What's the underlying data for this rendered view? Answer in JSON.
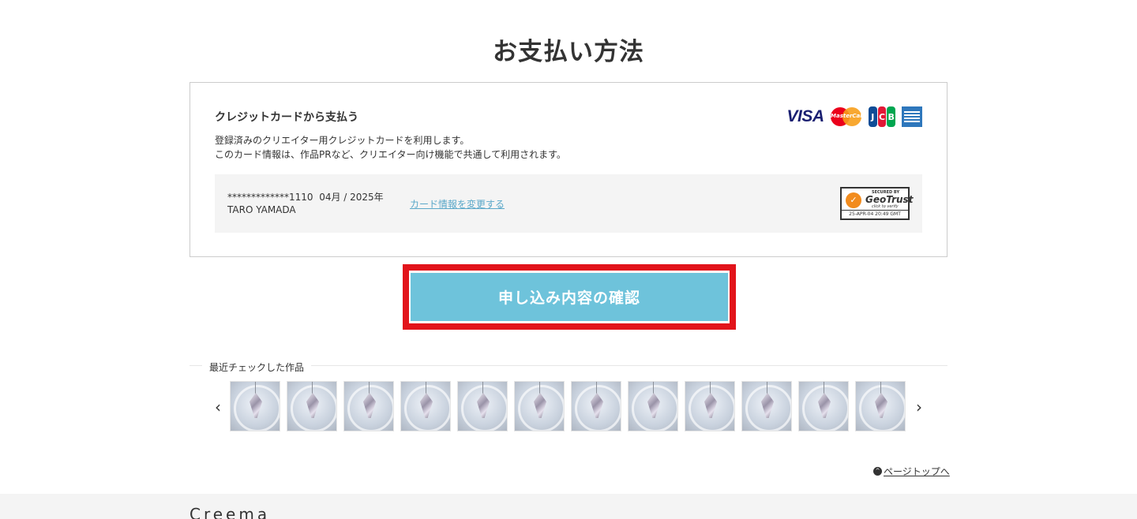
{
  "page": {
    "title": "お支払い方法"
  },
  "payment": {
    "heading": "クレジットカードから支払う",
    "desc_line1": "登録済みのクリエイター用クレジットカードを利用します。",
    "desc_line2": "このカード情報は、作品PRなど、クリエイター向け機能で共通して利用されます。",
    "card_number": "*************1110",
    "card_expiry": "04月 / 2025年",
    "card_holder": "TARO YAMADA",
    "change_link": "カード情報を変更する",
    "card_brands": [
      "VISA",
      "MasterCard",
      "JCB",
      "AMEX"
    ],
    "geotrust": {
      "secured_by": "SECURED BY",
      "name": "GeoTrust",
      "click": "click to verify",
      "date": "25-APR-04 20:49 GMT"
    }
  },
  "confirm": {
    "label": "申し込み内容の確認",
    "highlight_color": "#e2141b",
    "button_color": "#6ec3db"
  },
  "recent": {
    "title": "最近チェックした作品",
    "items_count_label": "",
    "items": [
      {
        "alt": "crystal"
      },
      {
        "alt": "crystal"
      },
      {
        "alt": "crystal"
      },
      {
        "alt": "crystal"
      },
      {
        "alt": "crystal"
      },
      {
        "alt": "crystal"
      },
      {
        "alt": "crystal"
      },
      {
        "alt": "crystal"
      },
      {
        "alt": "crystal"
      },
      {
        "alt": "crystal"
      },
      {
        "alt": "crystal"
      },
      {
        "alt": "crystal"
      }
    ],
    "prev_icon": "‹",
    "next_icon": "›"
  },
  "page_top": {
    "label": "ページトップへ",
    "icon": "^"
  },
  "footer": {
    "logo": "Creema"
  }
}
